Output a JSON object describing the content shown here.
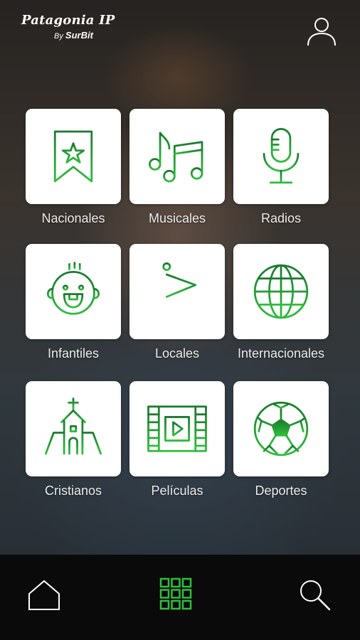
{
  "brand": {
    "name": "Patagonia IP",
    "by": "By",
    "sub": "SurBit"
  },
  "colors": {
    "icon_green_top": "#1a7a2e",
    "icon_green_bottom": "#2fbd3c",
    "nav_active": "#2fbd3c",
    "nav_bg": "#0a0a0a",
    "card_bg": "#ffffff"
  },
  "categories": [
    {
      "label": "Nacionales",
      "icon": "bookmark-star-icon"
    },
    {
      "label": "Musicales",
      "icon": "music-notes-icon"
    },
    {
      "label": "Radios",
      "icon": "microphone-icon"
    },
    {
      "label": "Infantiles",
      "icon": "baby-face-icon"
    },
    {
      "label": "Locales",
      "icon": "flag-icon"
    },
    {
      "label": "Internacionales",
      "icon": "globe-icon"
    },
    {
      "label": "Cristianos",
      "icon": "church-icon"
    },
    {
      "label": "Películas",
      "icon": "film-strip-icon"
    },
    {
      "label": "Deportes",
      "icon": "soccer-ball-icon"
    }
  ],
  "nav": {
    "items": [
      "home-icon",
      "grid-icon",
      "search-icon"
    ],
    "active": "grid-icon"
  }
}
